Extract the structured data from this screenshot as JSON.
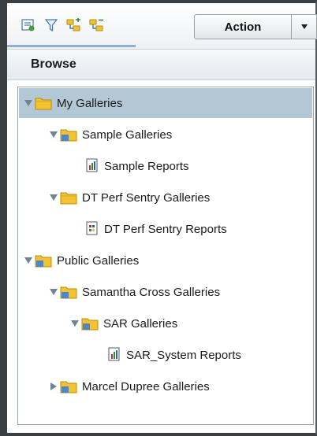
{
  "toolbar": {
    "icons": [
      "properties-icon",
      "filter-icon",
      "expand-all-icon",
      "collapse-all-icon"
    ],
    "action_label": "Action"
  },
  "browse": {
    "title": "Browse"
  },
  "tree": [
    {
      "label": "My Galleries",
      "type": "folder",
      "state": "expanded",
      "selected": true
    },
    {
      "label": "Sample Galleries",
      "type": "shared-folder",
      "state": "expanded"
    },
    {
      "label": "Sample Reports",
      "type": "report"
    },
    {
      "label": "DT Perf Sentry Galleries",
      "type": "folder",
      "state": "expanded"
    },
    {
      "label": "DT Perf Sentry Reports",
      "type": "report"
    },
    {
      "label": "Public Galleries",
      "type": "shared-folder",
      "state": "expanded"
    },
    {
      "label": "Samantha Cross Galleries",
      "type": "shared-folder",
      "state": "expanded"
    },
    {
      "label": "SAR Galleries",
      "type": "shared-folder",
      "state": "expanded"
    },
    {
      "label": "SAR_System Reports",
      "type": "report"
    },
    {
      "label": "Marcel Dupree Galleries",
      "type": "shared-folder",
      "state": "collapsed"
    }
  ],
  "colors": {
    "selection": "#b3c8d5",
    "folder": "#f2c230",
    "frame": "#3a3f44"
  }
}
